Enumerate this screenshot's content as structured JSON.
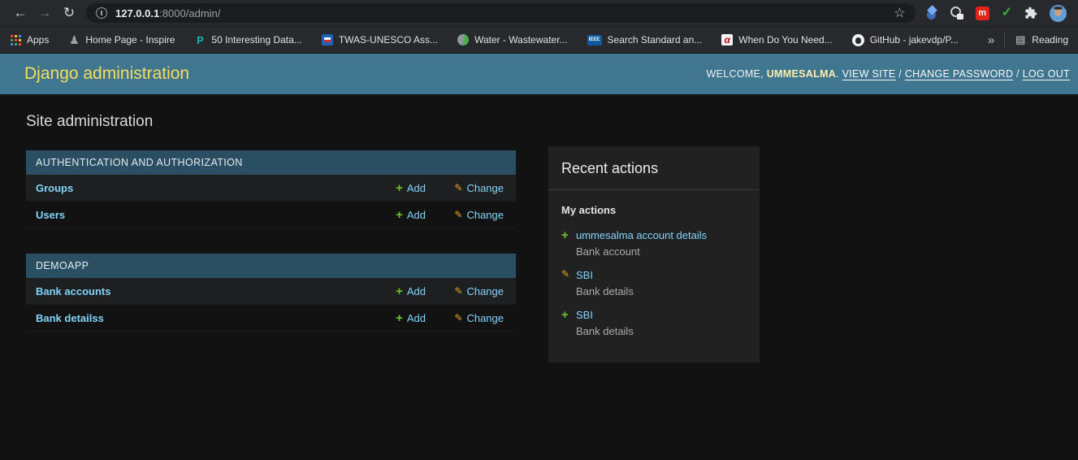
{
  "browser": {
    "toolbar": {
      "url_host": "127.0.0.1",
      "url_path": ":8000/admin/",
      "icons": {
        "back": "←",
        "forward": "→",
        "reload": "↻",
        "bookmark_star": "☆",
        "green_check": "✓",
        "mendeley_letter": "m"
      }
    },
    "bookmarks": {
      "apps_label": "Apps",
      "items": [
        {
          "label": "Home Page - Inspire",
          "icon": "pawn-icon",
          "glyph": "♟"
        },
        {
          "label": "50 Interesting Data...",
          "icon": "teal-logo-icon",
          "glyph": "P"
        },
        {
          "label": "TWAS-UNESCO Ass...",
          "icon": "twas-flag-icon"
        },
        {
          "label": "Water - Wastewater...",
          "icon": "globe-icon"
        },
        {
          "label": "Search Standard an...",
          "icon": "ieee-icon",
          "glyph": "IEEE"
        },
        {
          "label": "When Do You Need...",
          "icon": "alpha-icon",
          "glyph": "α"
        },
        {
          "label": "GitHub - jakevdp/P...",
          "icon": "github-icon"
        }
      ],
      "overflow_chevron": "»",
      "reading_list_glyph": "▤",
      "reading_list_label": "Reading"
    }
  },
  "admin": {
    "branding": "Django administration",
    "user_tools": {
      "welcome_prefix": "WELCOME, ",
      "username": "UMMESALMA",
      "period": ". ",
      "view_site": "VIEW SITE",
      "sep": " / ",
      "change_password": "CHANGE PASSWORD",
      "log_out": "LOG OUT"
    },
    "page_title": "Site administration",
    "add_glyph": "+",
    "change_glyph": "✎",
    "modules": [
      {
        "caption": "AUTHENTICATION AND AUTHORIZATION",
        "rows": [
          {
            "name": "Groups",
            "add_label": "Add",
            "change_label": "Change"
          },
          {
            "name": "Users",
            "add_label": "Add",
            "change_label": "Change"
          }
        ]
      },
      {
        "caption": "DEMOAPP",
        "rows": [
          {
            "name": "Bank accounts",
            "add_label": "Add",
            "change_label": "Change"
          },
          {
            "name": "Bank detailss",
            "add_label": "Add",
            "change_label": "Change"
          }
        ]
      }
    ],
    "recent_actions": {
      "title": "Recent actions",
      "subtitle": "My actions",
      "entries": [
        {
          "action": "add",
          "link": "ummesalma account details",
          "object_type": "Bank account"
        },
        {
          "action": "change",
          "link": "SBI",
          "object_type": "Bank details"
        },
        {
          "action": "add",
          "link": "SBI",
          "object_type": "Bank details"
        }
      ]
    },
    "colors": {
      "header_bg": "#417690",
      "branding_text": "#f5dd5d",
      "link": "#81d4fa",
      "add_green": "#70bf2b",
      "change_yellow": "#e9a718",
      "module_caption_bg": "#2a4e62",
      "body_bg": "#121212",
      "panel_bg": "#212121"
    }
  }
}
